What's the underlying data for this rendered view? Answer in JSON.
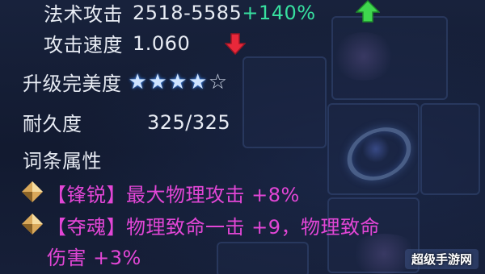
{
  "stats": {
    "magic_attack_label": "法术攻击",
    "magic_attack_value": "2518-5585",
    "magic_attack_bonus": "+140%",
    "attack_speed_label": "攻击速度",
    "attack_speed_value": "1.060",
    "upgrade_label": "升级完美度",
    "upgrade_stars_filled": 4,
    "upgrade_stars_total": 5,
    "durability_label": "耐久度",
    "durability_value": "325/325"
  },
  "affix_section": {
    "title": "词条属性",
    "items": [
      {
        "tag": "【锋锐】",
        "text": "最大物理攻击 +8%"
      },
      {
        "tag": "【夺魂】",
        "text": "物理致命一击 +9，物理致命",
        "text2": "伤害 +3%"
      }
    ]
  },
  "icons": {
    "attack_trend": "arrow-up-icon",
    "speed_trend": "arrow-down-icon",
    "affix_bullet": "diamond-gem-icon",
    "star": "star-icon"
  },
  "colors": {
    "up": "#37e0a0",
    "down": "#e8283a",
    "affix": "#e246d6",
    "star_fill": "#cfe4ff"
  },
  "watermark": "超级手游网"
}
